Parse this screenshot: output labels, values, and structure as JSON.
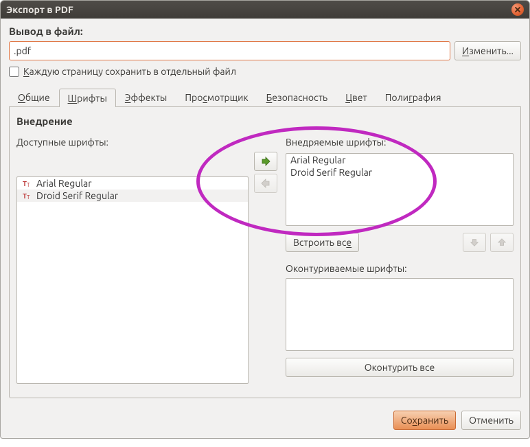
{
  "title": "Экспорт в PDF",
  "file": {
    "label": "Вывод в файл:",
    "value": ".pdf",
    "change_btn_pre": "",
    "change_btn_u": "И",
    "change_btn_post": "зменить...",
    "checkbox_pre": "",
    "checkbox_u": "К",
    "checkbox_post": "аждую страницу сохранить в отдельный файл"
  },
  "tabs": {
    "t0_pre": "",
    "t0_u": "О",
    "t0_post": "бщие",
    "t1_pre": "",
    "t1_u": "Ш",
    "t1_post": "рифты",
    "t2_pre": "",
    "t2_u": "Э",
    "t2_post": "ффекты",
    "t3": "Про",
    "t3_u": "с",
    "t3_post": "мотрщик",
    "t4_pre": "",
    "t4_u": "Б",
    "t4_post": "езопасность",
    "t5_pre": "",
    "t5_u": "Ц",
    "t5_post": "вет",
    "t6": "Поли",
    "t6_u": "г",
    "t6_post": "рафия"
  },
  "fonts_tab": {
    "section": "Внедрение",
    "available_label": "Доступные шрифты:",
    "embed_label": "Внедряемые шрифты:",
    "available_items": {
      "0": "Arial Regular",
      "1": "Droid Serif Regular"
    },
    "embed_items": {
      "0": "Arial Regular",
      "1": "Droid Serif Regular"
    },
    "embed_all_pre": "Встроить вс",
    "embed_all_u": "е",
    "embed_all_post": "",
    "outline_label": "Оконтуриваемые шрифты:",
    "outline_all": "Оконтурить все"
  },
  "footer": {
    "save_pre": "Со",
    "save_u": "х",
    "save_post": "ранить",
    "cancel": "Отменить"
  }
}
